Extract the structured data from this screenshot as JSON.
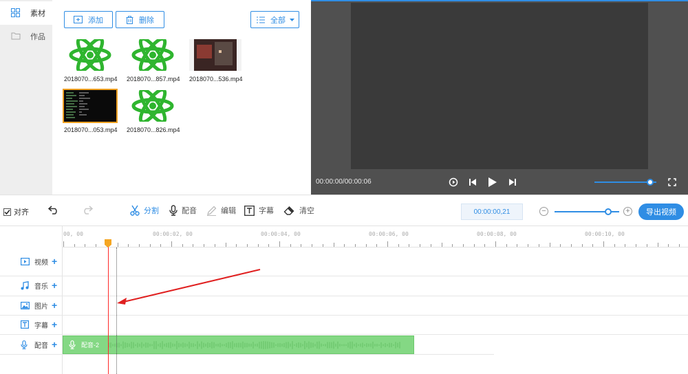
{
  "sidebar": {
    "items": [
      {
        "label": "素材",
        "icon": "grid-icon",
        "active": true
      },
      {
        "label": "作品",
        "icon": "folder-icon",
        "active": false
      }
    ]
  },
  "materials": {
    "add_label": "添加",
    "delete_label": "删除",
    "filter_label": "全部",
    "items": [
      {
        "name": "2018070...653.mp4",
        "thumb": "green-logo"
      },
      {
        "name": "2018070...857.mp4",
        "thumb": "green-logo"
      },
      {
        "name": "2018070...536.mp4",
        "thumb": "dark-video"
      },
      {
        "name": "2018070...053.mp4",
        "thumb": "black-screen",
        "selected": true
      },
      {
        "name": "2018070...826.mp4",
        "thumb": "green-logo"
      }
    ]
  },
  "preview": {
    "time": "00:00:00/00:00:06",
    "volume": 0.9
  },
  "toolbar": {
    "snap_label": "对齐",
    "snap_checked": true,
    "split_label": "分割",
    "dub_label": "配音",
    "edit_label": "编辑",
    "subtitle_label": "字幕",
    "clear_label": "清空",
    "current_time": "00:00:00,21",
    "zoom_level": 0.83,
    "export_label": "导出视频"
  },
  "timeline": {
    "ruler_labels": [
      "00, 00",
      "00:00:02, 00",
      "00:00:04, 00",
      "00:00:06, 00",
      "00:00:08, 00",
      "00:00:10, 00"
    ],
    "tracks": [
      {
        "label": "视频",
        "icon": "video-icon"
      },
      {
        "label": "音乐",
        "icon": "music-icon"
      },
      {
        "label": "图片",
        "icon": "image-icon"
      },
      {
        "label": "字幕",
        "icon": "text-icon"
      },
      {
        "label": "配音",
        "icon": "mic-icon"
      }
    ],
    "clip_label": "配音-2"
  },
  "colors": {
    "accent": "#2f8de4",
    "clip_green": "#84d884",
    "playhead": "#ff2a2a",
    "annotation_arrow": "#e02020"
  }
}
